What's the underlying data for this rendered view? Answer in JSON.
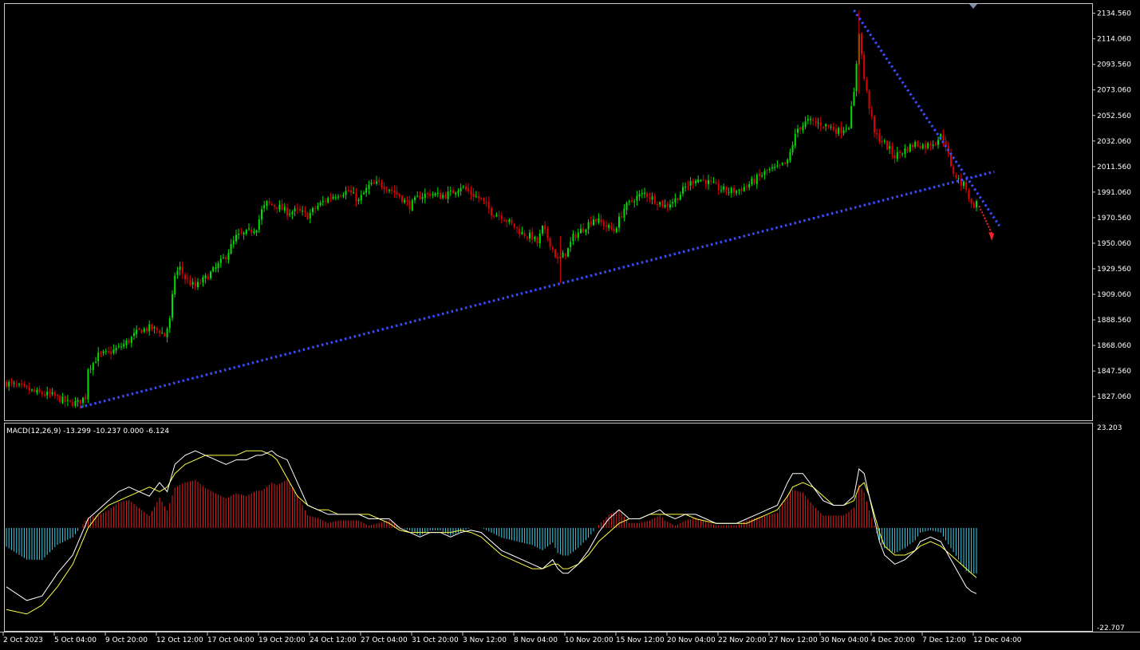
{
  "chart_data": [
    {
      "type": "candlestick",
      "title": "",
      "price_axis": {
        "ticks": [
          "2134.560",
          "2114.060",
          "2093.560",
          "2073.060",
          "2052.560",
          "2032.060",
          "2011.560",
          "1991.060",
          "1970.560",
          "1950.060",
          "1929.560",
          "1909.060",
          "1888.560",
          "1868.060",
          "1847.560",
          "1827.060"
        ],
        "tick_values": [
          2134.56,
          2114.06,
          2093.56,
          2073.06,
          2052.56,
          2032.06,
          2011.56,
          1991.06,
          1970.56,
          1950.06,
          1929.56,
          1909.06,
          1888.56,
          1868.06,
          1847.56,
          1827.06
        ],
        "ylim": [
          1808.0,
          2142.0
        ]
      },
      "time_axis": {
        "labels": [
          "2 Oct 2023",
          "5 Oct 04:00",
          "9 Oct 20:00",
          "12 Oct 12:00",
          "17 Oct 04:00",
          "19 Oct 20:00",
          "24 Oct 12:00",
          "27 Oct 04:00",
          "31 Oct 20:00",
          "3 Nov 12:00",
          "8 Nov 04:00",
          "10 Nov 20:00",
          "15 Nov 12:00",
          "20 Nov 04:00",
          "22 Nov 20:00",
          "27 Nov 12:00",
          "30 Nov 04:00",
          "4 Dec 20:00",
          "7 Dec 12:00",
          "12 Dec 04:00"
        ]
      },
      "colors": {
        "bull": "#00e000",
        "bear": "#e00000",
        "trendline": "#3a4bff",
        "projection": "#ff2020"
      },
      "close_path": [
        [
          0,
          1838
        ],
        [
          6,
          1834
        ],
        [
          12,
          1830
        ],
        [
          18,
          1828
        ],
        [
          24,
          1822
        ],
        [
          28,
          1822
        ],
        [
          31,
          1827
        ],
        [
          32,
          1850
        ],
        [
          34,
          1854
        ],
        [
          36,
          1860
        ],
        [
          40,
          1862
        ],
        [
          44,
          1866
        ],
        [
          48,
          1872
        ],
        [
          52,
          1880
        ],
        [
          56,
          1882
        ],
        [
          60,
          1880
        ],
        [
          62,
          1876
        ],
        [
          64,
          1888
        ],
        [
          66,
          1925
        ],
        [
          68,
          1930
        ],
        [
          70,
          1922
        ],
        [
          72,
          1918
        ],
        [
          74,
          1915
        ],
        [
          78,
          1922
        ],
        [
          82,
          1930
        ],
        [
          86,
          1940
        ],
        [
          90,
          1955
        ],
        [
          94,
          1958
        ],
        [
          98,
          1963
        ],
        [
          100,
          1976
        ],
        [
          102,
          1982
        ],
        [
          106,
          1980
        ],
        [
          110,
          1975
        ],
        [
          114,
          1976
        ],
        [
          118,
          1972
        ],
        [
          122,
          1980
        ],
        [
          126,
          1986
        ],
        [
          130,
          1990
        ],
        [
          134,
          1992
        ],
        [
          138,
          1984
        ],
        [
          142,
          1996
        ],
        [
          146,
          1998
        ],
        [
          150,
          1994
        ],
        [
          154,
          1988
        ],
        [
          158,
          1980
        ],
        [
          162,
          1988
        ],
        [
          166,
          1990
        ],
        [
          170,
          1988
        ],
        [
          174,
          1990
        ],
        [
          178,
          1996
        ],
        [
          182,
          1990
        ],
        [
          186,
          1985
        ],
        [
          190,
          1975
        ],
        [
          194,
          1972
        ],
        [
          198,
          1965
        ],
        [
          202,
          1958
        ],
        [
          206,
          1955
        ],
        [
          208,
          1950
        ],
        [
          210,
          1962
        ],
        [
          212,
          1955
        ],
        [
          214,
          1945
        ],
        [
          216,
          1936
        ],
        [
          218,
          1940
        ],
        [
          220,
          1945
        ],
        [
          222,
          1955
        ],
        [
          226,
          1962
        ],
        [
          230,
          1970
        ],
        [
          234,
          1965
        ],
        [
          238,
          1960
        ],
        [
          242,
          1978
        ],
        [
          246,
          1986
        ],
        [
          250,
          1990
        ],
        [
          254,
          1985
        ],
        [
          258,
          1980
        ],
        [
          262,
          1985
        ],
        [
          266,
          1995
        ],
        [
          270,
          2002
        ],
        [
          274,
          2000
        ],
        [
          278,
          1995
        ],
        [
          282,
          1992
        ],
        [
          286,
          1992
        ],
        [
          290,
          1996
        ],
        [
          294,
          2002
        ],
        [
          298,
          2008
        ],
        [
          302,
          2010
        ],
        [
          306,
          2015
        ],
        [
          308,
          2030
        ],
        [
          310,
          2042
        ],
        [
          314,
          2048
        ],
        [
          318,
          2046
        ],
        [
          322,
          2044
        ],
        [
          326,
          2040
        ],
        [
          330,
          2045
        ],
        [
          332,
          2070
        ],
        [
          334,
          2120
        ],
        [
          336,
          2082
        ],
        [
          338,
          2060
        ],
        [
          340,
          2038
        ],
        [
          344,
          2030
        ],
        [
          348,
          2020
        ],
        [
          352,
          2025
        ],
        [
          356,
          2030
        ],
        [
          360,
          2028
        ],
        [
          364,
          2032
        ],
        [
          366,
          2036
        ],
        [
          368,
          2030
        ],
        [
          370,
          2010
        ],
        [
          372,
          2004
        ],
        [
          374,
          1998
        ],
        [
          376,
          1995
        ],
        [
          378,
          1980
        ],
        [
          380,
          1982
        ]
      ],
      "trendlines": [
        {
          "from": [
            "2 Oct 2023 bar 31",
            1818.5
          ],
          "to": [
            "bar 392",
            2009.0
          ],
          "style": "dotted"
        },
        {
          "from": [
            "bar 334",
            2137.0
          ],
          "to": [
            "bar 396",
            1964.0
          ],
          "style": "dotted"
        }
      ],
      "projection": {
        "from": [
          "bar 380",
          1982.0
        ],
        "to": [
          "bar 389",
          1952.0
        ],
        "style": "dotted-arrow"
      }
    },
    {
      "type": "histogram_with_lines",
      "label": "MACD(12,26,9) -13.299 -10.237 0.000 -6.124",
      "value_axis": {
        "ticks": [
          "23.203",
          "-22.707"
        ],
        "ylim": [
          -22.707,
          23.203
        ]
      },
      "colors": {
        "positive": "#e02020",
        "negative": "#40d0e8",
        "macd_line": "#ffffff",
        "signal_line": "#ffff40"
      },
      "macd_path": [
        [
          0,
          -13
        ],
        [
          8,
          -16
        ],
        [
          14,
          -15
        ],
        [
          20,
          -10
        ],
        [
          26,
          -6
        ],
        [
          32,
          2
        ],
        [
          36,
          4
        ],
        [
          40,
          6
        ],
        [
          44,
          8
        ],
        [
          48,
          9
        ],
        [
          52,
          8
        ],
        [
          56,
          7
        ],
        [
          60,
          10
        ],
        [
          63,
          8
        ],
        [
          66,
          14
        ],
        [
          70,
          16
        ],
        [
          74,
          17
        ],
        [
          78,
          16
        ],
        [
          82,
          15
        ],
        [
          86,
          14
        ],
        [
          90,
          15
        ],
        [
          94,
          15
        ],
        [
          98,
          16
        ],
        [
          100,
          16
        ],
        [
          104,
          17
        ],
        [
          106,
          16
        ],
        [
          110,
          15
        ],
        [
          114,
          10
        ],
        [
          118,
          5
        ],
        [
          122,
          4
        ],
        [
          126,
          3
        ],
        [
          130,
          3
        ],
        [
          134,
          3
        ],
        [
          138,
          3
        ],
        [
          142,
          2
        ],
        [
          146,
          2
        ],
        [
          150,
          2
        ],
        [
          154,
          0
        ],
        [
          158,
          -1
        ],
        [
          162,
          -2
        ],
        [
          166,
          -1
        ],
        [
          170,
          -1
        ],
        [
          174,
          -2
        ],
        [
          178,
          -1
        ],
        [
          182,
          -0.5
        ],
        [
          186,
          -1
        ],
        [
          190,
          -3
        ],
        [
          194,
          -5
        ],
        [
          198,
          -6
        ],
        [
          202,
          -7
        ],
        [
          206,
          -8
        ],
        [
          210,
          -9
        ],
        [
          214,
          -7
        ],
        [
          216,
          -9
        ],
        [
          218,
          -10
        ],
        [
          220,
          -10
        ],
        [
          224,
          -8
        ],
        [
          228,
          -5
        ],
        [
          232,
          -1
        ],
        [
          236,
          2
        ],
        [
          240,
          4
        ],
        [
          244,
          2
        ],
        [
          248,
          2
        ],
        [
          252,
          3
        ],
        [
          256,
          4
        ],
        [
          258,
          3
        ],
        [
          262,
          2
        ],
        [
          266,
          3
        ],
        [
          270,
          3
        ],
        [
          274,
          2
        ],
        [
          278,
          1
        ],
        [
          282,
          1
        ],
        [
          286,
          1
        ],
        [
          290,
          2
        ],
        [
          294,
          3
        ],
        [
          298,
          4
        ],
        [
          302,
          5
        ],
        [
          306,
          10
        ],
        [
          308,
          12
        ],
        [
          312,
          12
        ],
        [
          316,
          9
        ],
        [
          320,
          6
        ],
        [
          324,
          5
        ],
        [
          328,
          5
        ],
        [
          332,
          7
        ],
        [
          334,
          13
        ],
        [
          336,
          12
        ],
        [
          338,
          7
        ],
        [
          340,
          2
        ],
        [
          342,
          -3
        ],
        [
          344,
          -6
        ],
        [
          348,
          -8
        ],
        [
          352,
          -7
        ],
        [
          356,
          -5
        ],
        [
          358,
          -3
        ],
        [
          362,
          -2
        ],
        [
          366,
          -3
        ],
        [
          370,
          -7
        ],
        [
          374,
          -11
        ],
        [
          376,
          -13
        ],
        [
          378,
          -14
        ],
        [
          380,
          -14.5
        ]
      ],
      "signal_path": [
        [
          0,
          -18
        ],
        [
          8,
          -19
        ],
        [
          14,
          -17
        ],
        [
          20,
          -13
        ],
        [
          26,
          -8
        ],
        [
          32,
          0
        ],
        [
          36,
          3
        ],
        [
          40,
          5
        ],
        [
          44,
          6
        ],
        [
          48,
          7
        ],
        [
          52,
          8
        ],
        [
          56,
          9
        ],
        [
          60,
          8
        ],
        [
          63,
          9
        ],
        [
          66,
          12
        ],
        [
          70,
          14
        ],
        [
          74,
          15
        ],
        [
          78,
          16
        ],
        [
          82,
          16
        ],
        [
          86,
          16
        ],
        [
          90,
          16
        ],
        [
          94,
          17
        ],
        [
          98,
          17
        ],
        [
          100,
          17
        ],
        [
          104,
          16
        ],
        [
          106,
          15
        ],
        [
          110,
          11
        ],
        [
          114,
          7
        ],
        [
          118,
          5
        ],
        [
          122,
          4
        ],
        [
          126,
          4
        ],
        [
          130,
          3
        ],
        [
          134,
          3
        ],
        [
          138,
          3
        ],
        [
          142,
          3
        ],
        [
          146,
          2
        ],
        [
          150,
          1
        ],
        [
          154,
          -0.5
        ],
        [
          158,
          -1
        ],
        [
          162,
          -1
        ],
        [
          166,
          -1
        ],
        [
          170,
          -1
        ],
        [
          174,
          -1
        ],
        [
          178,
          -0.5
        ],
        [
          182,
          -1
        ],
        [
          186,
          -2
        ],
        [
          190,
          -4
        ],
        [
          194,
          -6
        ],
        [
          198,
          -7
        ],
        [
          202,
          -8
        ],
        [
          206,
          -9
        ],
        [
          210,
          -9
        ],
        [
          214,
          -8
        ],
        [
          216,
          -8
        ],
        [
          218,
          -9
        ],
        [
          220,
          -9
        ],
        [
          224,
          -8
        ],
        [
          228,
          -6
        ],
        [
          232,
          -3
        ],
        [
          236,
          -1
        ],
        [
          240,
          1
        ],
        [
          244,
          2
        ],
        [
          248,
          2
        ],
        [
          252,
          3
        ],
        [
          256,
          3
        ],
        [
          258,
          3
        ],
        [
          262,
          3
        ],
        [
          266,
          3
        ],
        [
          270,
          2
        ],
        [
          278,
          1
        ],
        [
          282,
          1
        ],
        [
          286,
          1
        ],
        [
          290,
          1
        ],
        [
          294,
          2
        ],
        [
          298,
          3
        ],
        [
          302,
          4
        ],
        [
          306,
          7
        ],
        [
          308,
          9
        ],
        [
          312,
          10
        ],
        [
          316,
          9
        ],
        [
          320,
          7
        ],
        [
          324,
          5
        ],
        [
          328,
          5
        ],
        [
          332,
          6
        ],
        [
          334,
          9
        ],
        [
          336,
          10
        ],
        [
          338,
          7
        ],
        [
          340,
          3
        ],
        [
          342,
          -1
        ],
        [
          344,
          -4
        ],
        [
          348,
          -6
        ],
        [
          352,
          -6
        ],
        [
          356,
          -5
        ],
        [
          358,
          -4
        ],
        [
          362,
          -3
        ],
        [
          366,
          -4
        ],
        [
          370,
          -6
        ],
        [
          374,
          -8
        ],
        [
          376,
          -9
        ],
        [
          378,
          -10
        ],
        [
          380,
          -11
        ]
      ]
    }
  ]
}
